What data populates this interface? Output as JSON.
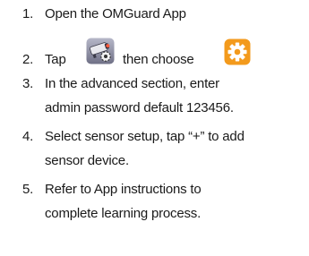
{
  "steps": [
    {
      "num": "1.",
      "lines": [
        "Open the OMGuard App"
      ]
    },
    {
      "num": "2.",
      "tap": "Tap",
      "then": "then choose",
      "icons": [
        "camera-app-icon",
        "settings-gear-icon"
      ]
    },
    {
      "num": "3.",
      "lines": [
        "In the advanced section, enter",
        "admin password default 123456."
      ]
    },
    {
      "num": "4.",
      "lines": [
        "Select sensor setup, tap “+” to add",
        "sensor device."
      ]
    },
    {
      "num": "5.",
      "lines": [
        "Refer to App instructions to",
        "complete learning process."
      ]
    }
  ],
  "colors": {
    "text": "#1a1a1a",
    "gear_bg": "#f39a1c",
    "camera_bg": "#8a8aa0"
  }
}
